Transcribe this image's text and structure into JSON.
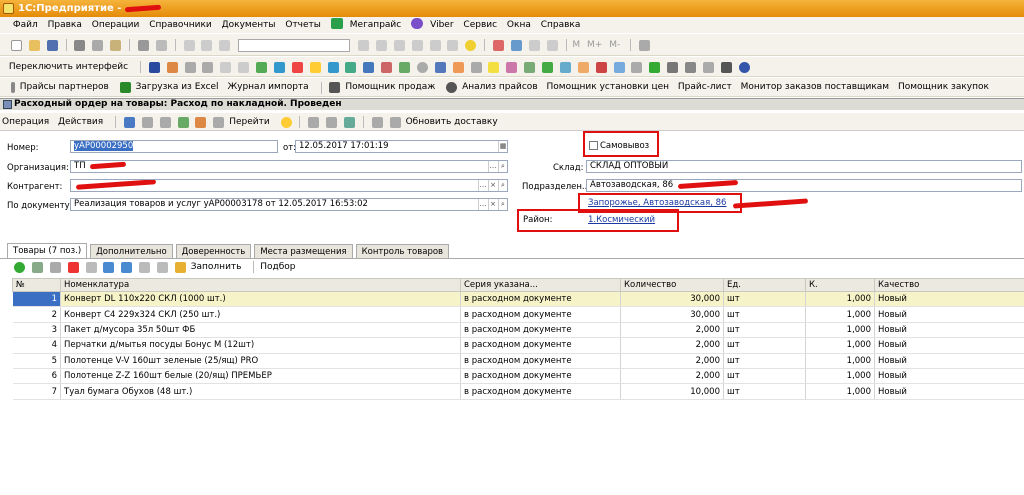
{
  "window": {
    "title": "1С:Предприятие - "
  },
  "menu": [
    "Файл",
    "Правка",
    "Операции",
    "Справочники",
    "Документы",
    "Отчеты",
    "Мегапрайс",
    "Viber",
    "Сервис",
    "Окна",
    "Справка"
  ],
  "toolbar1": {
    "letters": [
      "M",
      "M+",
      "M-"
    ]
  },
  "toolbar3": {
    "interface": "Переключить интерфейс",
    "items": [
      "Прайсы партнеров",
      "Загрузка из Excel",
      "Журнал импорта",
      "Помощник продаж",
      "Анализ прайсов",
      "Помощник установки цен",
      "Прайс-лист",
      "Монитор заказов поставщикам",
      "Помощник закупок"
    ]
  },
  "document": {
    "title": "Расходный ордер на товары: Расход по накладной. Проведен",
    "toolbar": {
      "operation": "Операция",
      "actions": "Действия",
      "goto": "Перейти",
      "refresh_delivery": "Обновить доставку"
    },
    "number_label": "Номер:",
    "number": "уАР00002950",
    "from_label": "от:",
    "date": "12.05.2017 17:01:19",
    "self_pickup_label": "Самовывоз",
    "org_label": "Организация:",
    "org": "ТП",
    "contractor_label": "Контрагент:",
    "contractor": "",
    "basis_label": "По документу:",
    "basis": "Реализация товаров и услуг уАР00003178 от 12.05.2017 16:53:02",
    "warehouse_label": "Склад:",
    "warehouse": "СКЛАД ОПТОВЫЙ",
    "division_label": "Подразделен...",
    "division": "Автозаводская, 86",
    "address": "Запорожье, Автозаводская, 86",
    "district_label": "Район:",
    "district": "1.Космический"
  },
  "tabs": [
    "Товары (7 поз.)",
    "Дополнительно",
    "Доверенность",
    "Места размещения",
    "Контроль товаров"
  ],
  "grid_toolbar": {
    "fill": "Заполнить",
    "select": "Подбор"
  },
  "table": {
    "columns": [
      "№",
      "Номенклатура",
      "Серия указана...",
      "Количество",
      "Ед.",
      "К.",
      "Качество"
    ],
    "rows": [
      [
        "1",
        "Конверт DL 110x220 СКЛ (1000 шт.)",
        "в расходном документе",
        "30,000",
        "шт",
        "1,000",
        "Новый"
      ],
      [
        "2",
        "Конверт С4 229x324 СКЛ (250 шт.)",
        "в расходном документе",
        "30,000",
        "шт",
        "1,000",
        "Новый"
      ],
      [
        "3",
        "Пакет д/мусора 35л 50шт ФБ",
        "в расходном документе",
        "2,000",
        "шт",
        "1,000",
        "Новый"
      ],
      [
        "4",
        "Перчатки д/мытья посуды Бонус М (12шт)",
        "в расходном документе",
        "2,000",
        "шт",
        "1,000",
        "Новый"
      ],
      [
        "5",
        "Полотенце V-V 160шт зеленые (25/ящ) PRO",
        "в расходном документе",
        "2,000",
        "шт",
        "1,000",
        "Новый"
      ],
      [
        "6",
        "Полотенце Z-Z 160шт белые (20/ящ) ПРЕМЬЕР",
        "в расходном документе",
        "2,000",
        "шт",
        "1,000",
        "Новый"
      ],
      [
        "7",
        "Туал бумага Обухов (48 шт.)",
        "в расходном документе",
        "10,000",
        "шт",
        "1,000",
        "Новый"
      ]
    ]
  },
  "colors": {
    "title_bar": "#f0a020",
    "annotation": "#e01010",
    "selected_row": "#3a6fc4",
    "link": "#1a3aa0"
  }
}
